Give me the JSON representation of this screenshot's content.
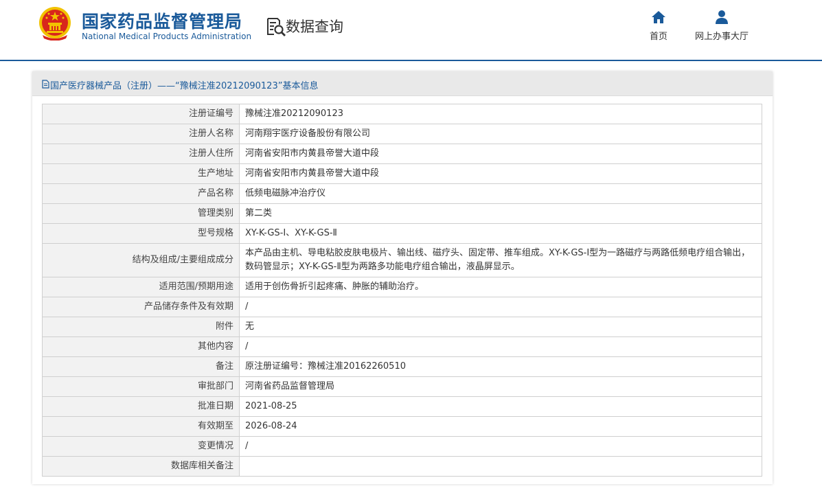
{
  "header": {
    "logo_cn": "国家药品监督管理局",
    "logo_en": "National Medical Products Administration",
    "query_title": "数据查询",
    "nav": [
      {
        "label": "首页",
        "icon": "home-icon"
      },
      {
        "label": "网上办事大厅",
        "icon": "user-icon"
      }
    ]
  },
  "panel": {
    "title": "国产医疗器械产品（注册）——“豫械注准20212090123”基本信息",
    "rows": [
      {
        "label": "注册证编号",
        "value": "豫械注准20212090123"
      },
      {
        "label": "注册人名称",
        "value": "河南翔宇医疗设备股份有限公司"
      },
      {
        "label": "注册人住所",
        "value": "河南省安阳市内黄县帝誉大道中段"
      },
      {
        "label": "生产地址",
        "value": "河南省安阳市内黄县帝誉大道中段"
      },
      {
        "label": "产品名称",
        "value": "低频电磁脉冲治疗仪"
      },
      {
        "label": "管理类别",
        "value": "第二类"
      },
      {
        "label": "型号规格",
        "value": "XY-K-GS-Ⅰ、XY-K-GS-Ⅱ"
      },
      {
        "label": "结构及组成/主要组成成分",
        "value": "本产品由主机、导电粘胶皮肤电极片、输出线、磁疗头、固定带、推车组成。XY-K-GS-Ⅰ型为一路磁疗与两路低频电疗组合输出，数码管显示；XY-K-GS-Ⅱ型为两路多功能电疗组合输出，液晶屏显示。"
      },
      {
        "label": "适用范围/预期用途",
        "value": "适用于创伤骨折引起疼痛、肿胀的辅助治疗。"
      },
      {
        "label": "产品储存条件及有效期",
        "value": "/"
      },
      {
        "label": "附件",
        "value": "无"
      },
      {
        "label": "其他内容",
        "value": "/"
      },
      {
        "label": "备注",
        "value": "原注册证编号：豫械注准20162260510"
      },
      {
        "label": "审批部门",
        "value": "河南省药品监督管理局"
      },
      {
        "label": "批准日期",
        "value": "2021-08-25"
      },
      {
        "label": "有效期至",
        "value": "2026-08-24"
      },
      {
        "label": "变更情况",
        "value": "/"
      },
      {
        "label": "数据库相关备注",
        "value": ""
      }
    ]
  },
  "colors": {
    "brand": "#1a5a9a",
    "emblem_red": "#d8261c",
    "emblem_gold": "#f2c200",
    "label_bg": "#f2f2f2",
    "panel_head_bg": "#e9e9e9"
  }
}
